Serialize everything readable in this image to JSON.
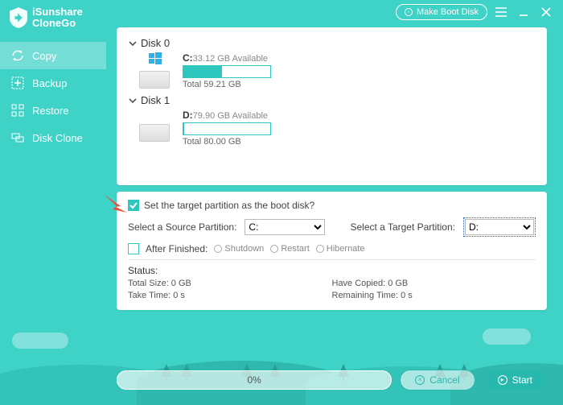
{
  "app": {
    "brand_line1": "iSunshare",
    "brand_line2": "CloneGo"
  },
  "titlebar": {
    "make_boot": "Make Boot Disk"
  },
  "sidebar": {
    "items": [
      {
        "label": "Copy"
      },
      {
        "label": "Backup"
      },
      {
        "label": "Restore"
      },
      {
        "label": "Disk Clone"
      }
    ]
  },
  "disks": {
    "disk0": {
      "title": "Disk 0",
      "drive_letter": "C:",
      "available": "33.12 GB Available",
      "total": "Total 59.21 GB",
      "fill_pct": 44
    },
    "disk1": {
      "title": "Disk 1",
      "drive_letter": "D:",
      "available": "79.90 GB Available",
      "total": "Total 80.00 GB",
      "fill_pct": 1
    }
  },
  "options": {
    "set_target_boot": "Set the target partition as the boot disk?",
    "source_label": "Select a Source Partition:",
    "target_label": "Select a Target Partition:",
    "source_value": "C:",
    "target_value": "D:",
    "after_finished": "After Finished:",
    "opt_shutdown": "Shutdown",
    "opt_restart": "Restart",
    "opt_hibernate": "Hibernate"
  },
  "status": {
    "title": "Status:",
    "total_size": "Total Size: 0 GB",
    "have_copied": "Have Copied: 0 GB",
    "take_time": "Take Time: 0 s",
    "remaining_time": "Remaining Time: 0 s"
  },
  "footer": {
    "progress": "0%",
    "cancel": "Cancel",
    "start": "Start"
  }
}
